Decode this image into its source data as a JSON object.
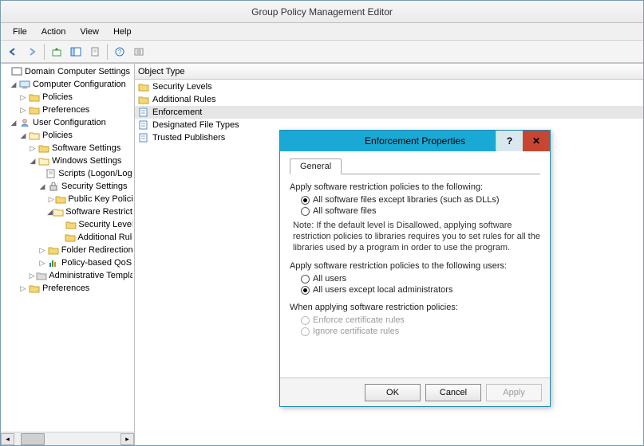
{
  "window": {
    "title": "Group Policy Management Editor"
  },
  "menus": {
    "file": "File",
    "action": "Action",
    "view": "View",
    "help": "Help"
  },
  "tree": {
    "root": "Domain Computer Settings",
    "cc": "Computer Configuration",
    "cc_policies": "Policies",
    "cc_prefs": "Preferences",
    "uc": "User Configuration",
    "uc_policies": "Policies",
    "sw_settings": "Software Settings",
    "win_settings": "Windows Settings",
    "scripts": "Scripts (Logon/Logoff)",
    "sec_settings": "Security Settings",
    "public_key": "Public Key Policies",
    "srp": "Software Restriction Policies",
    "srp_sec": "Security Levels",
    "srp_add": "Additional Rules",
    "folder_redir": "Folder Redirection",
    "policy_based": "Policy-based QoS",
    "admin_templ": "Administrative Templates",
    "uc_prefs": "Preferences"
  },
  "list": {
    "header": "Object Type",
    "items": [
      "Security Levels",
      "Additional Rules",
      "Enforcement",
      "Designated File Types",
      "Trusted Publishers"
    ],
    "selected": 2
  },
  "dialog": {
    "title": "Enforcement Properties",
    "tab": "General",
    "g1_label": "Apply software restriction policies to the following:",
    "g1_opt1": "All software files except libraries (such as DLLs)",
    "g1_opt2": "All software files",
    "note": "Note:  If the default level is Disallowed, applying software restriction policies to libraries requires you to set rules for all the libraries used by a program in order to use the program.",
    "g2_label": "Apply software restriction policies to the following users:",
    "g2_opt1": "All users",
    "g2_opt2": "All users except local administrators",
    "g3_label": "When applying software restriction policies:",
    "g3_opt1": "Enforce certificate rules",
    "g3_opt2": "Ignore certificate rules",
    "ok": "OK",
    "cancel": "Cancel",
    "apply": "Apply"
  }
}
